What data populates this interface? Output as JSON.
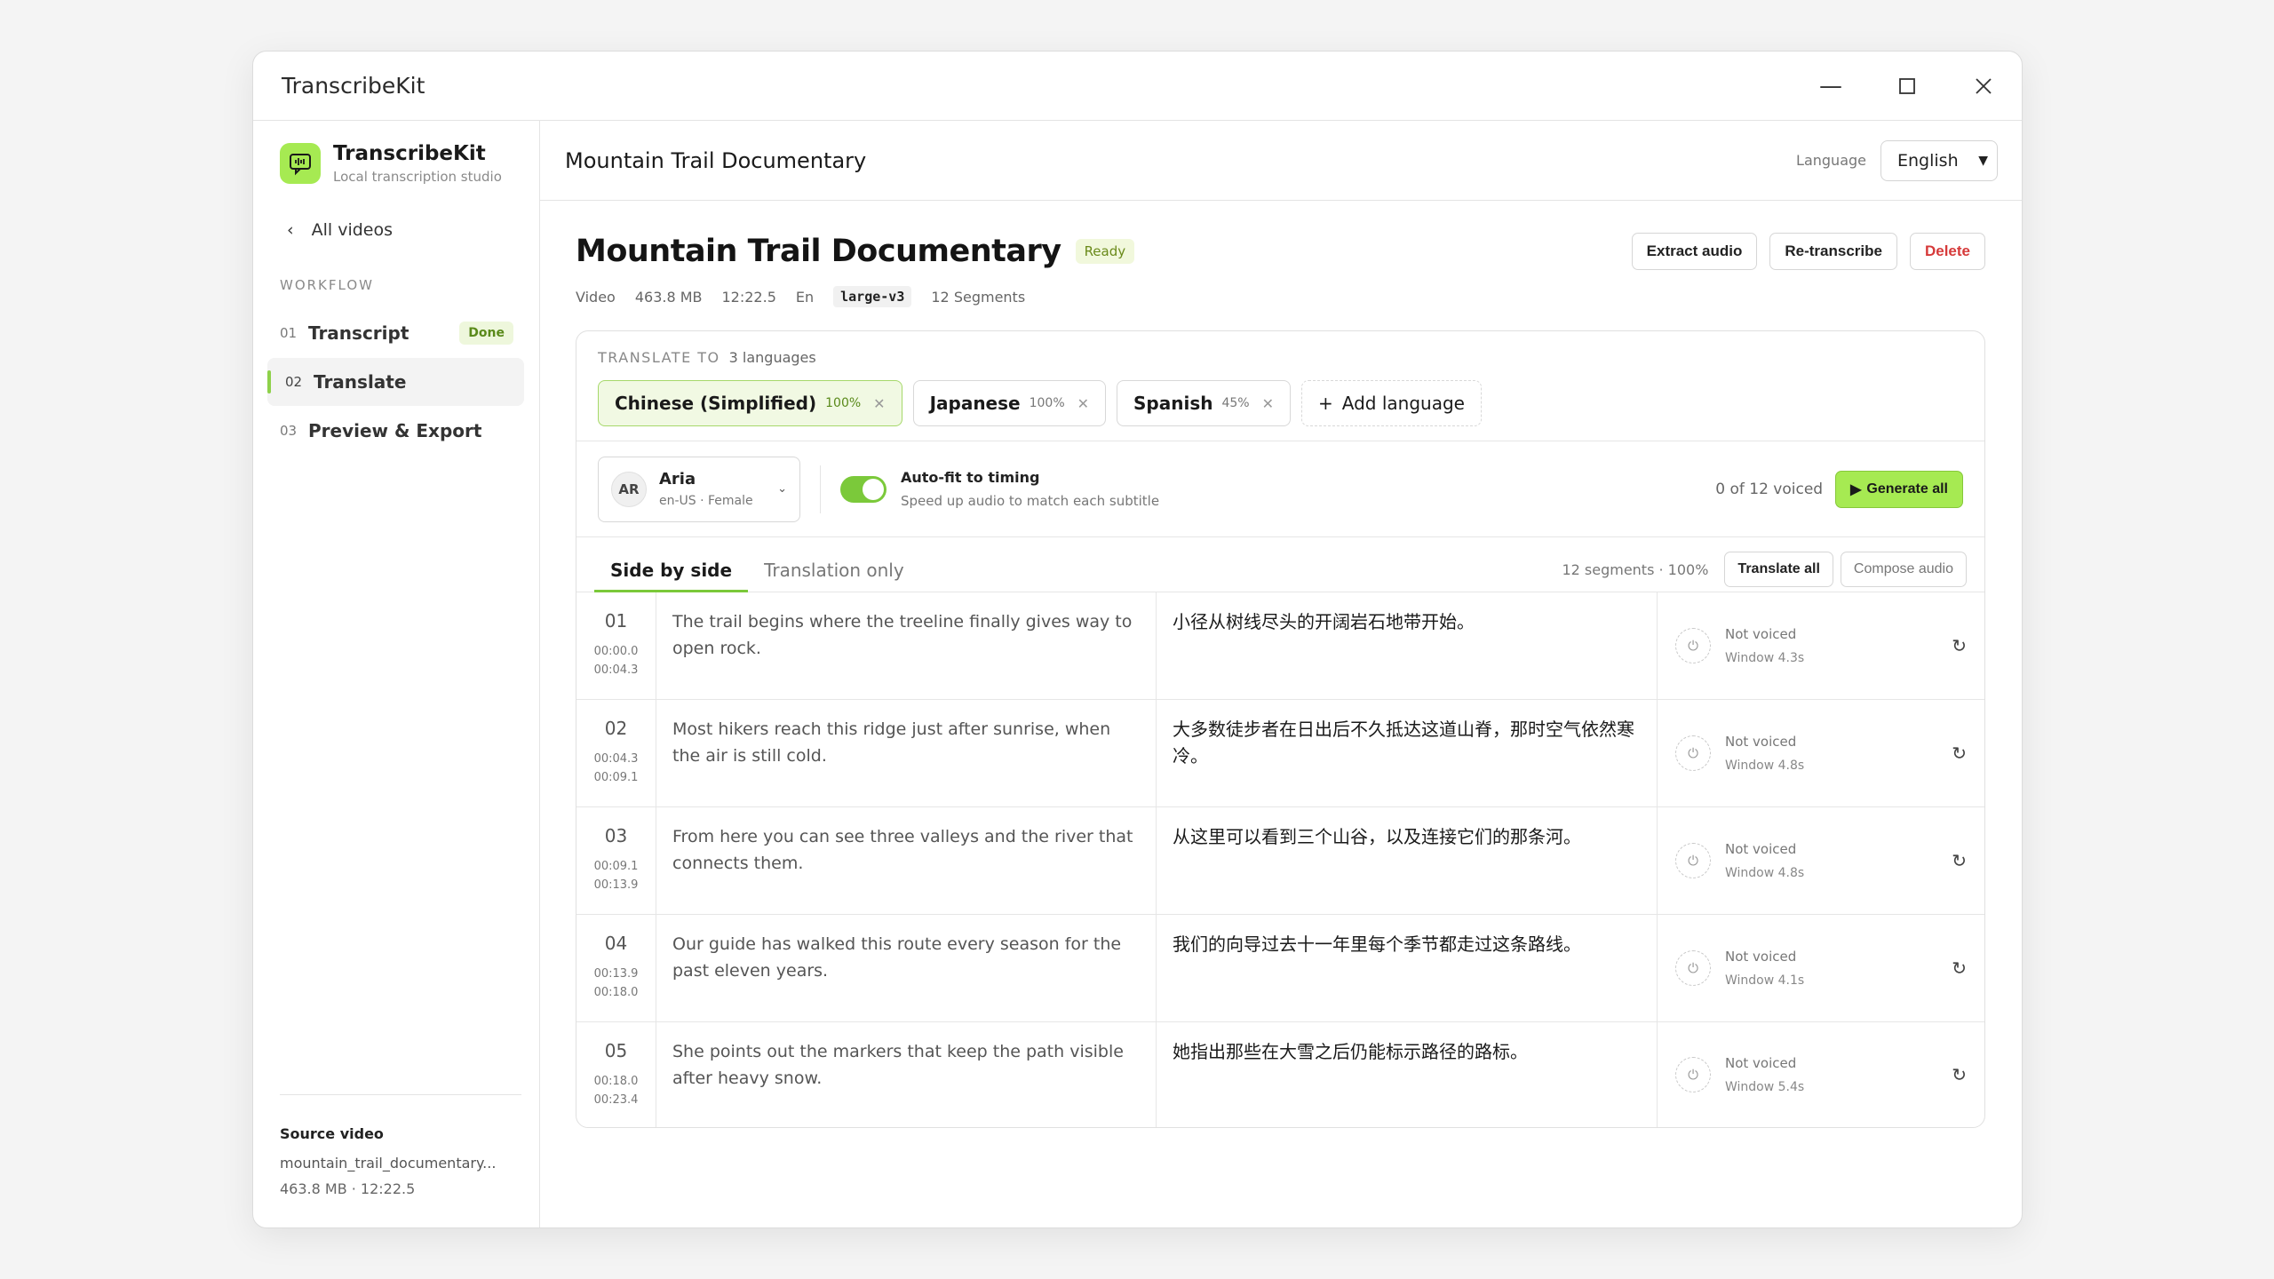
{
  "window": {
    "title": "TranscribeKit"
  },
  "sidebar": {
    "brand_name": "TranscribeKit",
    "brand_sub": "Local transcription studio",
    "back_label": "All videos",
    "workflow_label": "WORKFLOW",
    "items": [
      {
        "num": "01",
        "label": "Transcript",
        "badge": "Done"
      },
      {
        "num": "02",
        "label": "Translate"
      },
      {
        "num": "03",
        "label": "Preview & Export"
      }
    ],
    "source_title": "Source video",
    "source_file": "mountain_trail_documentary...",
    "source_meta": "463.8 MB · 12:22.5"
  },
  "topbar": {
    "title": "Mountain Trail Documentary",
    "language_label": "Language",
    "language_value": "English"
  },
  "header": {
    "title": "Mountain Trail Documentary",
    "status": "Ready",
    "extract_label": "Extract audio",
    "retranscribe_label": "Re-transcribe",
    "delete_label": "Delete",
    "meta": {
      "type": "Video",
      "size": "463.8 MB",
      "duration": "12:22.5",
      "lang": "En",
      "model": "large-v3",
      "segments": "12 Segments"
    }
  },
  "translate": {
    "label": "TRANSLATE TO",
    "count": "3 languages",
    "chips": [
      {
        "name": "Chinese (Simplified)",
        "pct": "100%"
      },
      {
        "name": "Japanese",
        "pct": "100%"
      },
      {
        "name": "Spanish",
        "pct": "45%"
      }
    ],
    "add_label": "Add language"
  },
  "voice": {
    "initials": "AR",
    "name": "Aria",
    "meta": "en-US · Female",
    "autofit_title": "Auto-fit to timing",
    "autofit_sub": "Speed up audio to match each subtitle",
    "voiced_status": "0 of 12 voiced",
    "generate_label": "Generate all"
  },
  "tabs": {
    "side_by_side": "Side by side",
    "translation_only": "Translation only",
    "seg_count": "12 segments · 100%",
    "translate_all": "Translate all",
    "compose_audio": "Compose audio"
  },
  "segments": [
    {
      "n": "01",
      "start": "00:00.0",
      "end": "00:04.3",
      "src": "The trail begins where the treeline finally gives way to open rock.",
      "tr": "小径从树线尽头的开阔岩石地带开始。",
      "status": "Not voiced",
      "window": "Window 4.3s"
    },
    {
      "n": "02",
      "start": "00:04.3",
      "end": "00:09.1",
      "src": "Most hikers reach this ridge just after sunrise, when the air is still cold.",
      "tr": "大多数徒步者在日出后不久抵达这道山脊，那时空气依然寒冷。",
      "status": "Not voiced",
      "window": "Window 4.8s"
    },
    {
      "n": "03",
      "start": "00:09.1",
      "end": "00:13.9",
      "src": "From here you can see three valleys and the river that connects them.",
      "tr": "从这里可以看到三个山谷，以及连接它们的那条河。",
      "status": "Not voiced",
      "window": "Window 4.8s"
    },
    {
      "n": "04",
      "start": "00:13.9",
      "end": "00:18.0",
      "src": "Our guide has walked this route every season for the past eleven years.",
      "tr": "我们的向导过去十一年里每个季节都走过这条路线。",
      "status": "Not voiced",
      "window": "Window 4.1s"
    },
    {
      "n": "05",
      "start": "00:18.0",
      "end": "00:23.4",
      "src": "She points out the markers that keep the path visible after heavy snow.",
      "tr": "她指出那些在大雪之后仍能标示路径的路标。",
      "status": "Not voiced",
      "window": "Window 5.4s"
    }
  ]
}
